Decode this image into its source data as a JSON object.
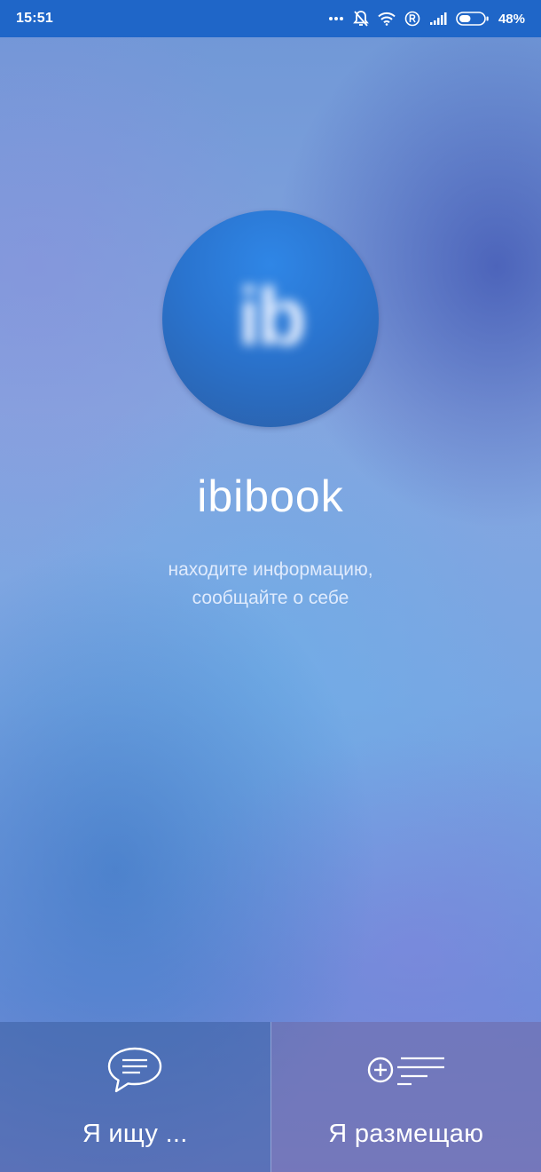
{
  "status_bar": {
    "time": "15:51",
    "battery_percent": "48%",
    "battery_level": 0.48,
    "icons": [
      "more-dots-icon",
      "mute-bell-icon",
      "wifi-icon",
      "registered-icon",
      "signal-icon",
      "battery-icon"
    ]
  },
  "splash": {
    "logo_text": "ib",
    "app_name": "ibibook",
    "tagline_line1": "находите информацию,",
    "tagline_line2": "сообщайте о себе"
  },
  "actions": {
    "search_label": "Я ищу ...",
    "search_icon": "chat-bubble-icon",
    "post_label": "Я размещаю",
    "post_icon": "add-list-icon"
  },
  "colors": {
    "status_bar": "#1f66c8",
    "logo": "#2a74cf",
    "text": "#ffffff"
  }
}
